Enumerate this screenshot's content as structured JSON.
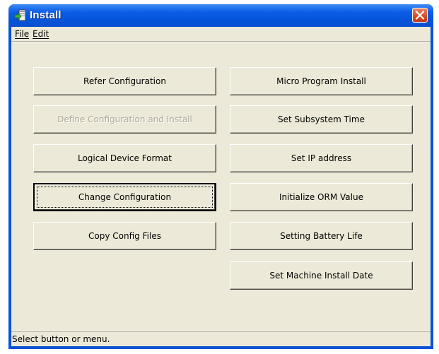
{
  "window": {
    "title": "Install"
  },
  "menu": {
    "file": "File",
    "edit": "Edit"
  },
  "buttons": {
    "refer_configuration": "Refer Configuration",
    "define_configuration_and_install": "Define Configuration and Install",
    "logical_device_format": "Logical Device Format",
    "change_configuration": "Change Configuration",
    "copy_config_files": "Copy Config Files",
    "micro_program_install": "Micro Program Install",
    "set_subsystem_time": "Set Subsystem Time",
    "set_ip_address": "Set IP address",
    "initialize_orm_value": "Initialize ORM Value",
    "setting_battery_life": "Setting Battery Life",
    "set_machine_install_date": "Set Machine Install Date"
  },
  "status": {
    "text": "Select button or menu."
  },
  "colors": {
    "titlebar": "#0a52d7",
    "face": "#ece9d8",
    "disabled_text": "#aca899",
    "close_button": "#d64a25"
  },
  "icons": {
    "app": "install-app-icon",
    "close": "close-icon"
  }
}
